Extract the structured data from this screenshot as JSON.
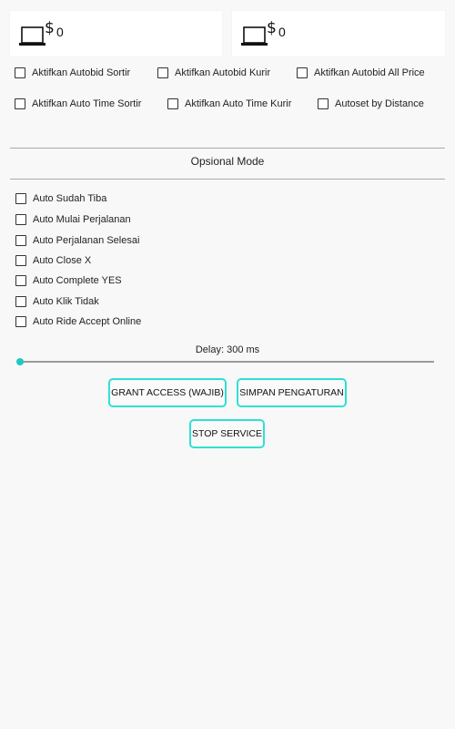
{
  "balances": [
    {
      "value": "0",
      "icon": "laptop-dollar-icon"
    },
    {
      "value": "0",
      "icon": "laptop-dollar-icon"
    }
  ],
  "autobid": {
    "row1": [
      "Aktifkan Autobid Sortir",
      "Aktifkan Autobid Kurir",
      "Aktifkan Autobid All Price"
    ],
    "row2": [
      "Aktifkan Auto Time Sortir",
      "Aktifkan Auto Time Kurir",
      "Autoset by Distance"
    ]
  },
  "optional_mode": {
    "title": "Opsional Mode",
    "items": [
      "Auto Sudah Tiba",
      "Auto Mulai Perjalanan",
      "Auto Perjalanan Selesai",
      "Auto Close X",
      "Auto Complete YES",
      "Auto Klik Tidak",
      "Auto Ride Accept Online"
    ]
  },
  "delay": {
    "label": "Delay: 300 ms",
    "fraction": 0.0
  },
  "buttons": {
    "grant": "GRANT ACCESS (WAJIB)",
    "simpan": "SIMPAN PENGATURAN",
    "stop": "STOP SERVICE"
  },
  "colors": {
    "accent": "#20c9bd",
    "button_border": "#2fe0d4",
    "background": "#f8f8f8"
  }
}
